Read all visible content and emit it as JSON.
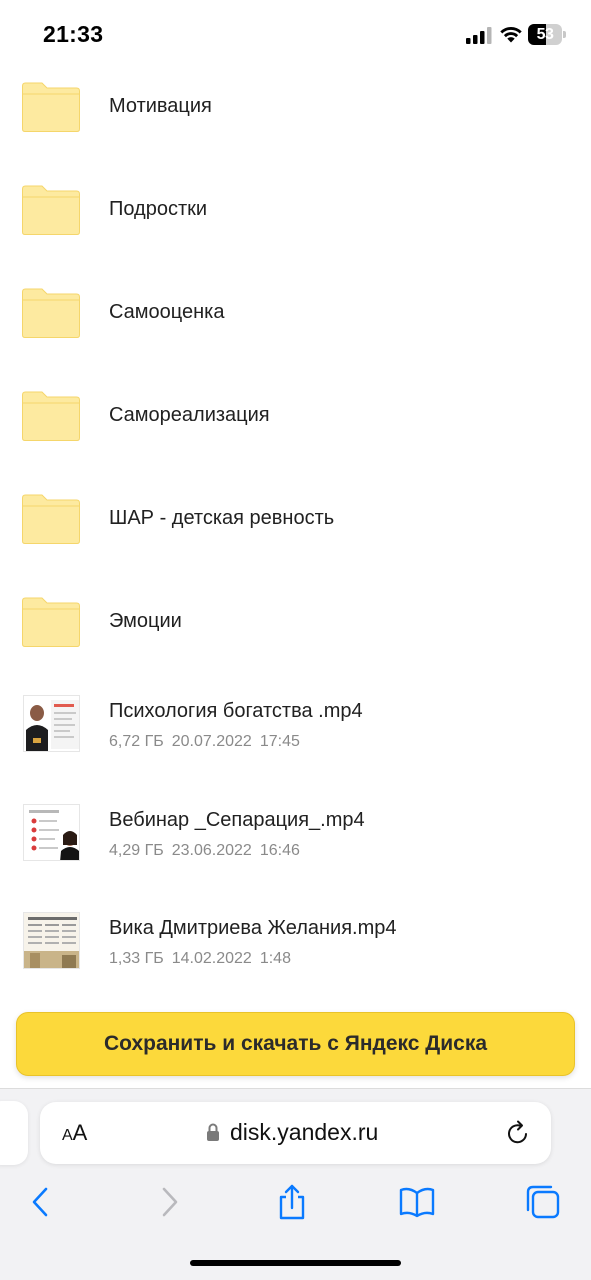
{
  "status_bar": {
    "time": "21:33",
    "battery_percent": "53",
    "battery_level": 0.53,
    "icons": [
      "cellular-signal-icon",
      "wifi-icon",
      "battery-icon"
    ]
  },
  "folders": [
    {
      "name": "Мотивация"
    },
    {
      "name": "Подростки"
    },
    {
      "name": "Самооценка"
    },
    {
      "name": "Самореализация"
    },
    {
      "name": "ШАР - детская ревность"
    },
    {
      "name": "Эмоции"
    }
  ],
  "files": [
    {
      "name": "Психология богатства .mp4",
      "size": "6,72 ГБ",
      "date": "20.07.2022",
      "time": "17:45",
      "thumbnail": "video-thumbnail-speaker"
    },
    {
      "name": "Вебинар _Сепарация_.mp4",
      "size": "4,29 ГБ",
      "date": "23.06.2022",
      "time": "16:46",
      "thumbnail": "video-thumbnail-slides"
    },
    {
      "name": "Вика Дмитриева Желания.mp4",
      "size": "1,33 ГБ",
      "date": "14.02.2022",
      "time": "1:48",
      "thumbnail": "video-thumbnail-document"
    }
  ],
  "save_button": {
    "label": "Сохранить и скачать с Яндекс Диска"
  },
  "browser": {
    "aa_label": "AA",
    "url": "disk.yandex.ru",
    "toolbar_icons": [
      "back-icon",
      "forward-icon",
      "share-icon",
      "bookmarks-icon",
      "tabs-icon"
    ]
  },
  "colors": {
    "folder": "#fdeaa0",
    "folder_border": "#f5d66b",
    "save_button": "#fcd93b",
    "safari_blue": "#0a7aff"
  }
}
